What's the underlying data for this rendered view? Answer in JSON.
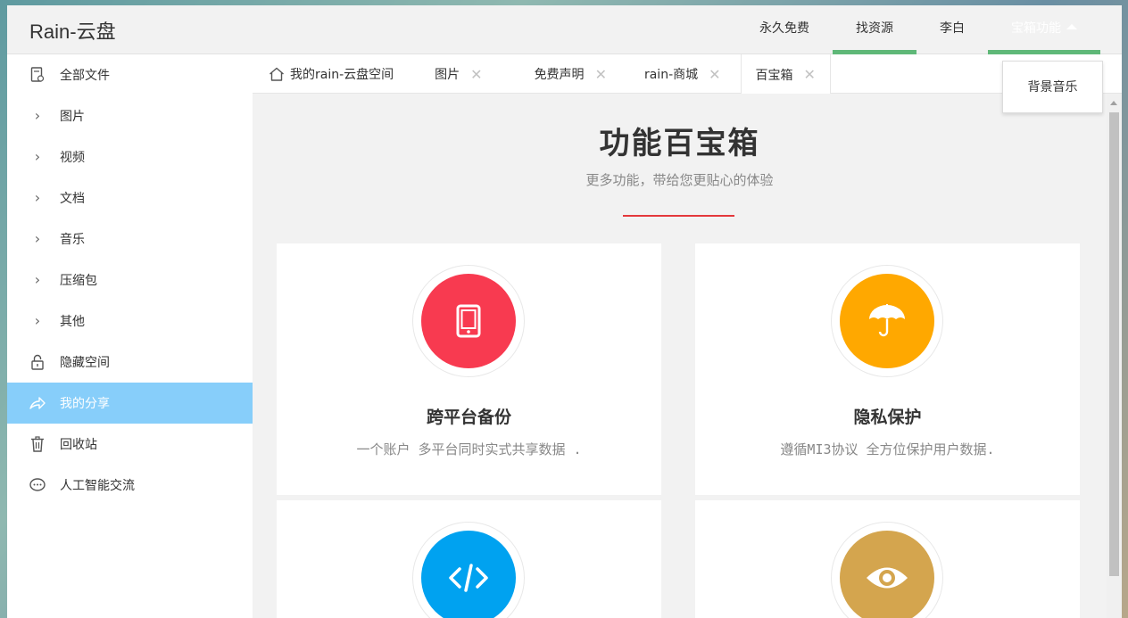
{
  "app": {
    "logo": "Rain-云盘"
  },
  "nav": {
    "items": [
      {
        "label": "永久免费",
        "active": false
      },
      {
        "label": "找资源",
        "active": true
      },
      {
        "label": "李白",
        "active": false
      },
      {
        "label": "宝箱功能",
        "active": true
      }
    ],
    "dropdown": {
      "items": [
        "背景音乐"
      ]
    }
  },
  "sidebar": {
    "items": [
      {
        "label": "全部文件",
        "icon": "file-icon"
      },
      {
        "label": "图片",
        "icon": "chevron-right-icon"
      },
      {
        "label": "视频",
        "icon": "chevron-right-icon"
      },
      {
        "label": "文档",
        "icon": "chevron-right-icon"
      },
      {
        "label": "音乐",
        "icon": "chevron-right-icon"
      },
      {
        "label": "压缩包",
        "icon": "chevron-right-icon"
      },
      {
        "label": "其他",
        "icon": "chevron-right-icon"
      },
      {
        "label": "隐藏空间",
        "icon": "lock-icon"
      },
      {
        "label": "我的分享",
        "icon": "share-icon",
        "active": true
      },
      {
        "label": "回收站",
        "icon": "trash-icon"
      },
      {
        "label": "人工智能交流",
        "icon": "chat-icon"
      }
    ]
  },
  "tabs": [
    {
      "label": "我的rain-云盘空间",
      "icon": "home-icon",
      "closable": false
    },
    {
      "label": "图片",
      "closable": true
    },
    {
      "label": "免费声明",
      "closable": true
    },
    {
      "label": "rain-商城",
      "closable": true
    },
    {
      "label": "百宝箱",
      "closable": true,
      "active": true
    }
  ],
  "main": {
    "title": "功能百宝箱",
    "subtitle": "更多功能，带给您更贴心的体验",
    "cards": [
      {
        "title": "跨平台备份",
        "desc": "一个账户 多平台同时实式共享数据 .",
        "icon": "tablet-icon",
        "color": "#f83a50"
      },
      {
        "title": "隐私保护",
        "desc": "遵循MI3协议 全方位保护用户数据.",
        "icon": "umbrella-icon",
        "color": "#ffa800"
      },
      {
        "title": "",
        "desc": "",
        "icon": "code-icon",
        "color": "#00a2f0"
      },
      {
        "title": "",
        "desc": "",
        "icon": "eye-icon",
        "color": "#d4a54e"
      }
    ]
  },
  "colors": {
    "accent_green": "#5fb878",
    "sidebar_active": "#87cefa",
    "divider_red": "#e4393c"
  }
}
